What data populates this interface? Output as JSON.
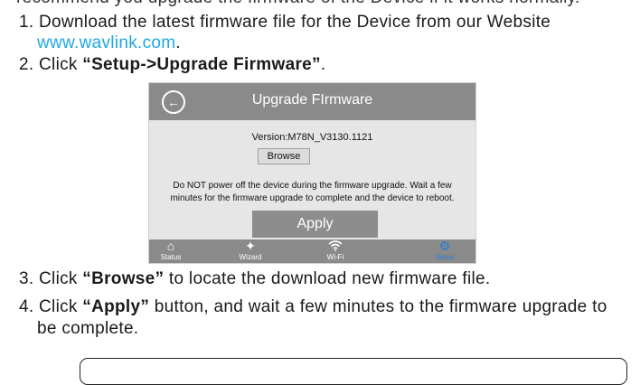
{
  "doc": {
    "top_cut": "recommend you upgrade the firmware of the Device if it works normally.",
    "step1_prefix": "1. Download the latest firmware file for the Device from our Website",
    "step1_link": "www.wavlink.com",
    "step1_end": ".",
    "step2_prefix": "2. Click ",
    "step2_bold": "“Setup->Upgrade Firmware”",
    "step2_end": ".",
    "step3_prefix": "3. Click ",
    "step3_bold": "“Browse”",
    "step3_end": " to locate the download new firmware file.",
    "step4_prefix": "4. Click ",
    "step4_bold": "“Apply”",
    "step4_end": " button, and wait a few minutes to the firmware upgrade to",
    "step4_cont": "be complete."
  },
  "device": {
    "title": "Upgrade FIrmware",
    "version": "Version:M78N_V3130.1121",
    "browse_label": "Browse",
    "warning": "Do NOT power off the device during the firmware upgrade. Wait a few minutes for the firmware upgrade to complete and the device to reboot.",
    "apply_label": "Apply",
    "nav": [
      {
        "label": "Status",
        "icon": "house-icon"
      },
      {
        "label": "Wizard",
        "icon": "magic-wand-icon"
      },
      {
        "label": "Wi-Fi",
        "icon": "wifi-icon"
      },
      {
        "label": "Setup",
        "icon": "gear-icon"
      }
    ],
    "colors": {
      "header": "#8a8a8a",
      "active_nav": "#2a7ed6",
      "link": "#1ea7df"
    }
  }
}
